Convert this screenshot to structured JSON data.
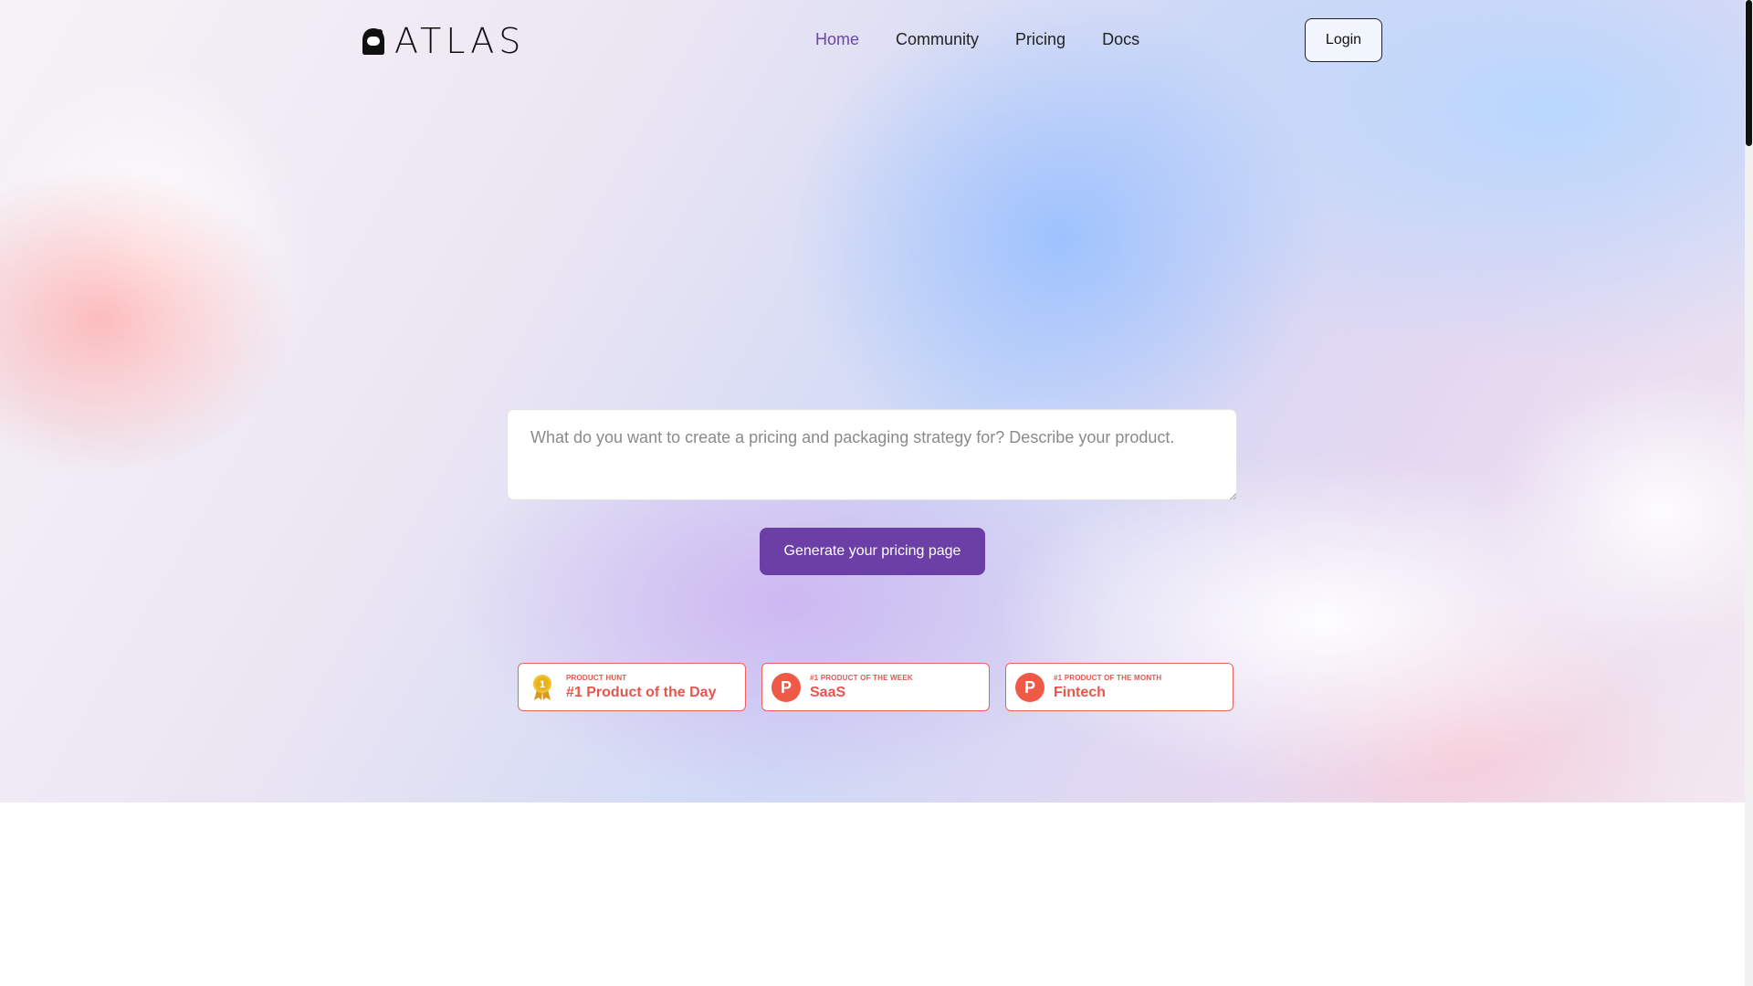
{
  "app": {
    "logo_text": "ATLAS"
  },
  "nav": {
    "links": [
      {
        "label": "Home",
        "active": true
      },
      {
        "label": "Community",
        "active": false
      },
      {
        "label": "Pricing",
        "active": false
      },
      {
        "label": "Docs",
        "active": false
      }
    ],
    "login_label": "Login"
  },
  "hero": {
    "prompt_placeholder": "What do you want to create a pricing and packaging strategy for? Describe your product.",
    "prompt_value": "",
    "generate_label": "Generate your pricing page"
  },
  "badges": [
    {
      "kicker": "PRODUCT HUNT",
      "title": "#1 Product of the Day",
      "icon": "medal-icon"
    },
    {
      "kicker": "#1 PRODUCT OF THE WEEK",
      "title": "SaaS",
      "icon": "product-hunt-icon"
    },
    {
      "kicker": "#1 PRODUCT OF THE MONTH",
      "title": "Fintech",
      "icon": "product-hunt-icon"
    }
  ],
  "colors": {
    "accent": "#6b3fa6",
    "nav_active": "#6b46a8",
    "badge": "#e8554e"
  },
  "icons": {
    "logo": "astronaut-helmet-icon",
    "medal_number": "1",
    "ph_letter": "P"
  }
}
